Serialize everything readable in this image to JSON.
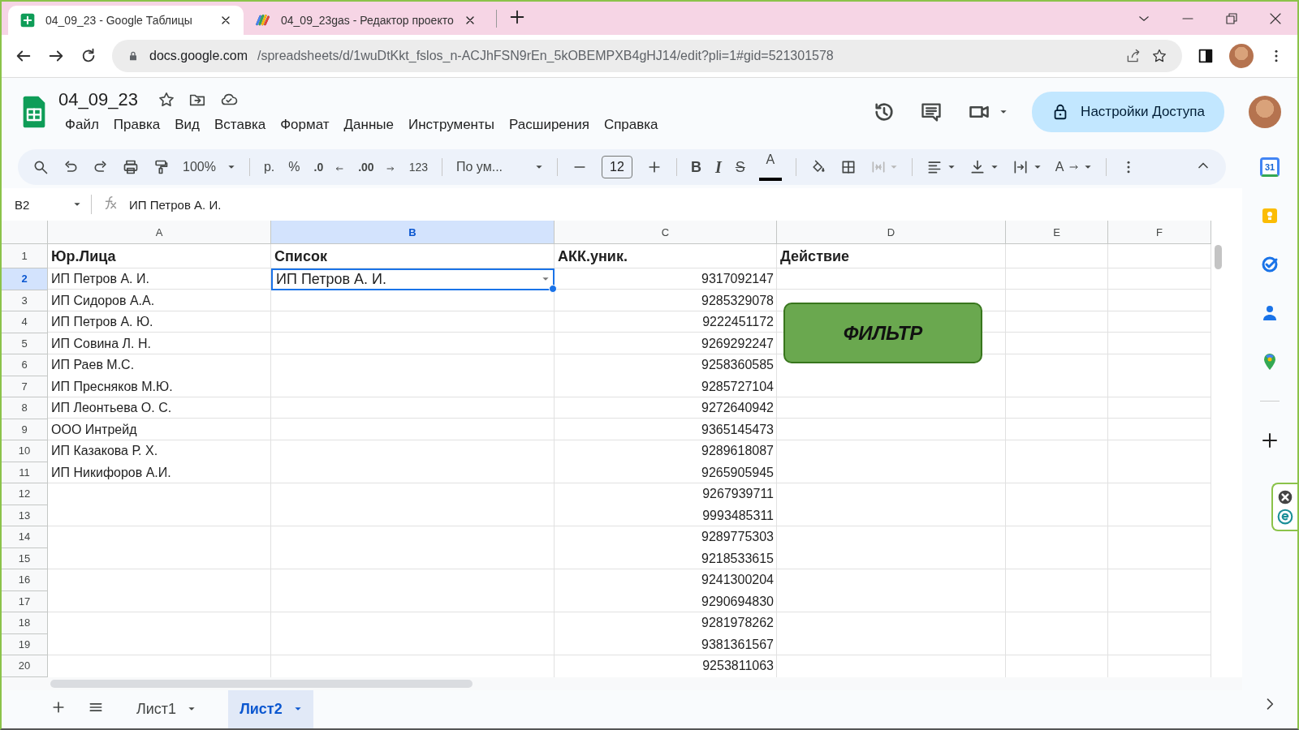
{
  "browser": {
    "tabs": [
      {
        "title": "04_09_23 - Google Таблицы",
        "selected": true
      },
      {
        "title": "04_09_23gas - Редактор проекто",
        "selected": false
      }
    ],
    "url_host": "docs.google.com",
    "url_path": "/spreadsheets/d/1wuDtKkt_fslos_n-ACJhFSN9rEn_5kOBEMPXB4gHJ14/edit?pli=1#gid=521301578"
  },
  "doc": {
    "title": "04_09_23",
    "menu": [
      "Файл",
      "Правка",
      "Вид",
      "Вставка",
      "Формат",
      "Данные",
      "Инструменты",
      "Расширения",
      "Справка"
    ],
    "share_label": "Настройки Доступа"
  },
  "toolbar": {
    "zoom": "100%",
    "currency": "р.",
    "percent": "%",
    "dec_less": ".0",
    "dec_more": ".00",
    "number_format": "123",
    "font": "По ум...",
    "font_size": "12",
    "bold": "B",
    "italic": "I",
    "strike": "S",
    "text_color": "A",
    "rotate": "A"
  },
  "formula_bar": {
    "cell_ref": "B2",
    "formula": "ИП Петров А. И."
  },
  "sheet": {
    "columns": [
      {
        "label": "A",
        "selected": false
      },
      {
        "label": "B",
        "selected": true
      },
      {
        "label": "C",
        "selected": false
      },
      {
        "label": "D",
        "selected": false
      },
      {
        "label": "E",
        "selected": false
      },
      {
        "label": "F",
        "selected": false
      }
    ],
    "rows": [
      {
        "number": "1",
        "selected": false,
        "kind": "header",
        "a": "Юр.Лица",
        "b": "Список",
        "c": "АКК.уник.",
        "d": "Действие"
      },
      {
        "number": "2",
        "selected": true,
        "kind": "data",
        "a": "ИП Петров А. И.",
        "b": "ИП Петров А. И.",
        "c": "9317092147"
      },
      {
        "number": "3",
        "selected": false,
        "kind": "data",
        "a": "ИП Сидоров А.А.",
        "c": "9285329078"
      },
      {
        "number": "4",
        "selected": false,
        "kind": "data",
        "a": "ИП Петров А. Ю.",
        "c": "9222451172"
      },
      {
        "number": "5",
        "selected": false,
        "kind": "data",
        "a": "ИП Совина Л. Н.",
        "c": "9269292247"
      },
      {
        "number": "6",
        "selected": false,
        "kind": "data",
        "a": "ИП Раев М.С.",
        "c": "9258360585"
      },
      {
        "number": "7",
        "selected": false,
        "kind": "data",
        "a": "ИП Пресняков М.Ю.",
        "c": "9285727104"
      },
      {
        "number": "8",
        "selected": false,
        "kind": "data",
        "a": "ИП Леонтьева О. С.",
        "c": "9272640942"
      },
      {
        "number": "9",
        "selected": false,
        "kind": "data",
        "a": "ООО Интрейд",
        "c": "9365145473"
      },
      {
        "number": "10",
        "selected": false,
        "kind": "data",
        "a": "ИП Казакова Р. Х.",
        "c": "9289618087"
      },
      {
        "number": "11",
        "selected": false,
        "kind": "data",
        "a": "ИП Никифоров А.И.",
        "c": "9265905945"
      },
      {
        "number": "12",
        "selected": false,
        "kind": "data",
        "c": "9267939711"
      },
      {
        "number": "13",
        "selected": false,
        "kind": "data",
        "c": "9993485311"
      },
      {
        "number": "14",
        "selected": false,
        "kind": "data",
        "c": "9289775303"
      },
      {
        "number": "15",
        "selected": false,
        "kind": "data",
        "c": "9218533615"
      },
      {
        "number": "16",
        "selected": false,
        "kind": "data",
        "c": "9241300204"
      },
      {
        "number": "17",
        "selected": false,
        "kind": "data",
        "c": "9290694830"
      },
      {
        "number": "18",
        "selected": false,
        "kind": "data",
        "c": "9281978262"
      },
      {
        "number": "19",
        "selected": false,
        "kind": "data",
        "c": "9381361567"
      },
      {
        "number": "20",
        "selected": false,
        "kind": "data",
        "c": "9253811063"
      }
    ],
    "drawing": {
      "label": "ФИЛЬТР"
    }
  },
  "sheet_tabs": [
    {
      "label": "Лист1",
      "selected": false
    },
    {
      "label": "Лист2",
      "selected": true
    }
  ],
  "side_panel": {
    "calendar_day": "31"
  }
}
